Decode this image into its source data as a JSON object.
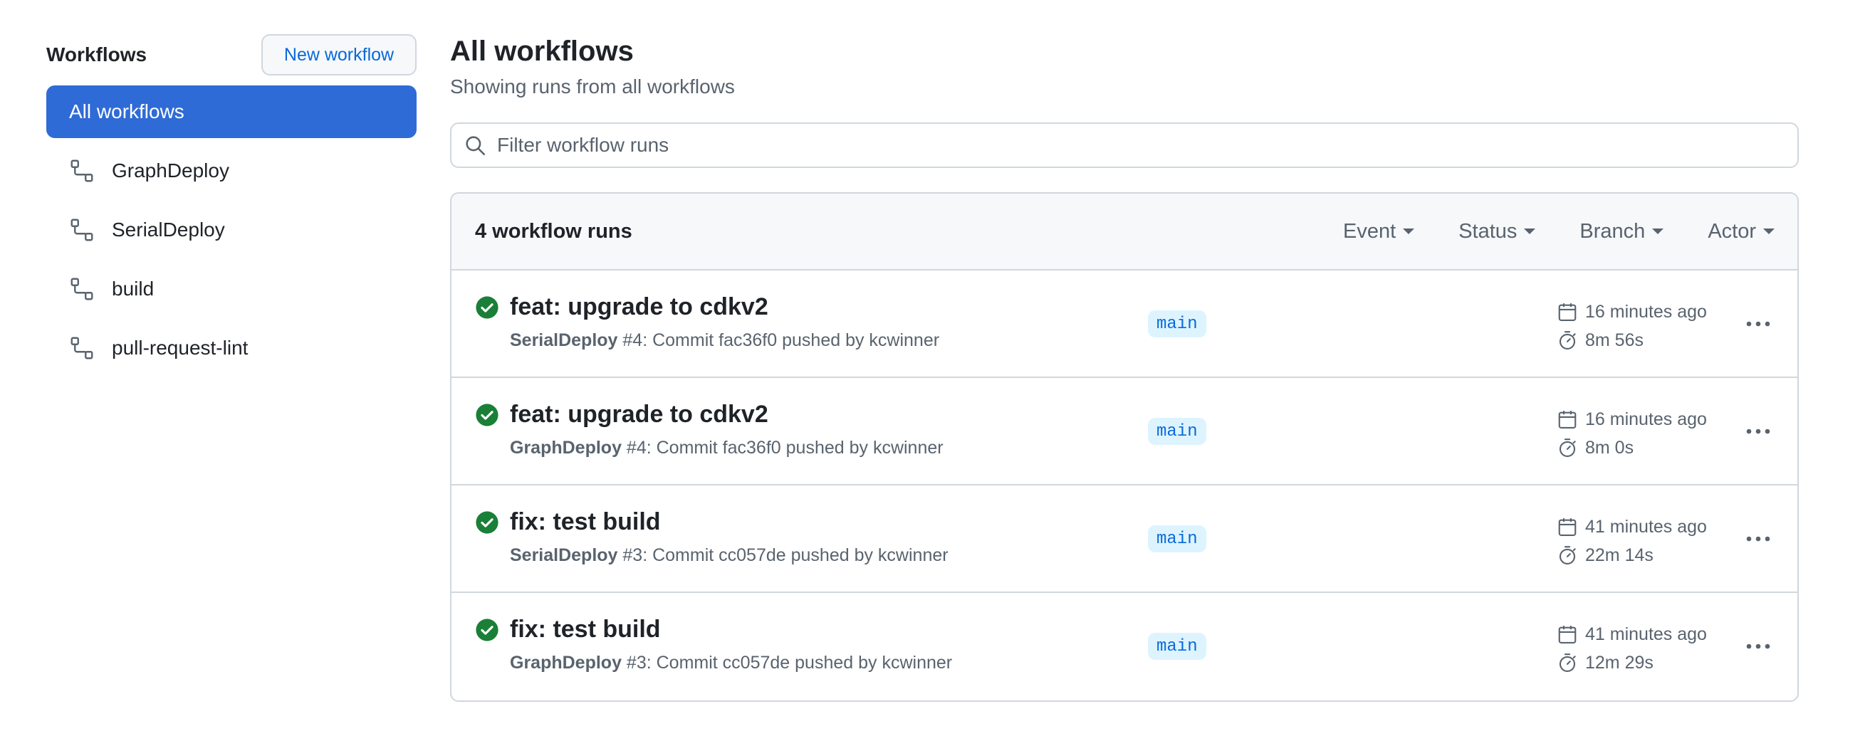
{
  "sidebar": {
    "title": "Workflows",
    "new_workflow_label": "New workflow",
    "items": [
      {
        "label": "All workflows",
        "active": true,
        "icon": ""
      },
      {
        "label": "GraphDeploy",
        "active": false,
        "icon": "workflow-icon"
      },
      {
        "label": "SerialDeploy",
        "active": false,
        "icon": "workflow-icon"
      },
      {
        "label": "build",
        "active": false,
        "icon": "workflow-icon"
      },
      {
        "label": "pull-request-lint",
        "active": false,
        "icon": "workflow-icon"
      }
    ]
  },
  "main": {
    "title": "All workflows",
    "subtitle": "Showing runs from all workflows",
    "search": {
      "placeholder": "Filter workflow runs",
      "value": ""
    },
    "runs_count": "4 workflow runs",
    "filters": [
      "Event",
      "Status",
      "Branch",
      "Actor"
    ],
    "runs": [
      {
        "title": "feat: upgrade to cdkv2",
        "workflow": "SerialDeploy",
        "detail": " #4: Commit fac36f0 pushed by kcwinner",
        "branch": "main",
        "time_ago": "16 minutes ago",
        "duration": "8m 56s",
        "status": "success"
      },
      {
        "title": "feat: upgrade to cdkv2",
        "workflow": "GraphDeploy",
        "detail": " #4: Commit fac36f0 pushed by kcwinner",
        "branch": "main",
        "time_ago": "16 minutes ago",
        "duration": "8m 0s",
        "status": "success"
      },
      {
        "title": "fix: test build",
        "workflow": "SerialDeploy",
        "detail": " #3: Commit cc057de pushed by kcwinner",
        "branch": "main",
        "time_ago": "41 minutes ago",
        "duration": "22m 14s",
        "status": "success"
      },
      {
        "title": "fix: test build",
        "workflow": "GraphDeploy",
        "detail": " #3: Commit cc057de pushed by kcwinner",
        "branch": "main",
        "time_ago": "41 minutes ago",
        "duration": "12m 29s",
        "status": "success"
      }
    ]
  },
  "colors": {
    "accent": "#2f6bd6",
    "link": "#0969da",
    "success": "#1a7f37",
    "muted": "#59636e",
    "border": "#d0d7de"
  }
}
